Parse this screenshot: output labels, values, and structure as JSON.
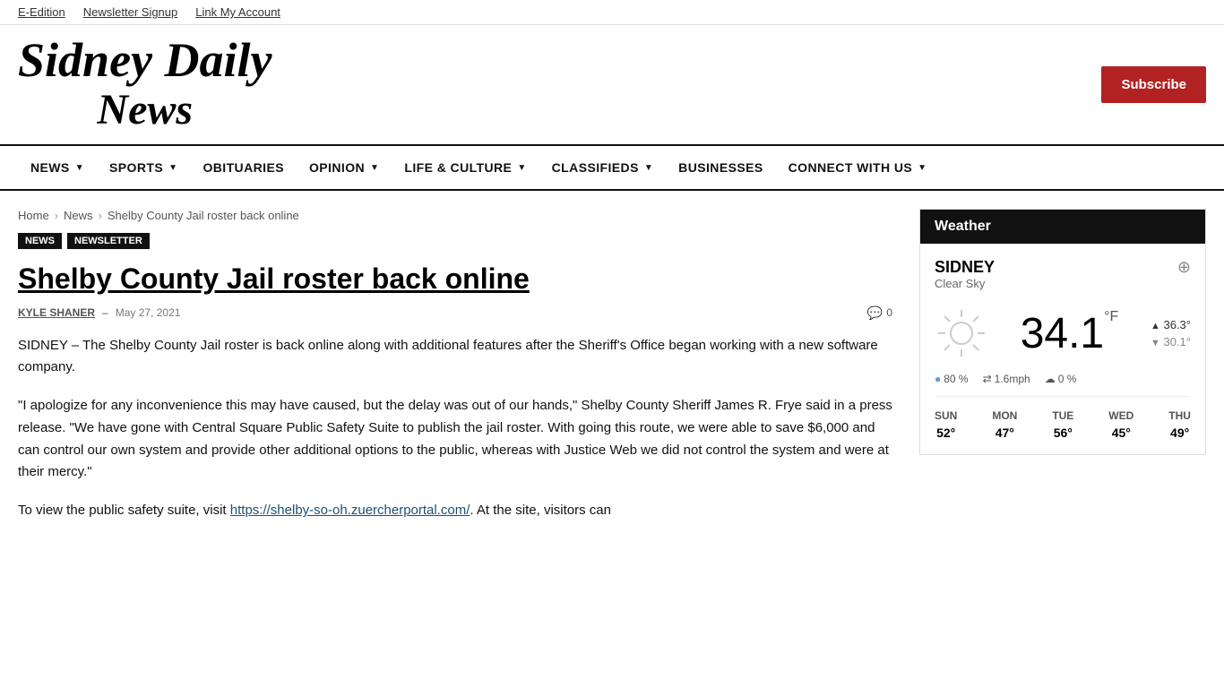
{
  "topbar": {
    "links": [
      {
        "label": "E-Edition"
      },
      {
        "label": "Newsletter Signup"
      },
      {
        "label": "Link My Account"
      }
    ]
  },
  "header": {
    "logo_line1": "Sidney Daily",
    "logo_line2": "News",
    "subscribe_label": "Subscribe"
  },
  "nav": {
    "items": [
      {
        "label": "NEWS",
        "has_dropdown": true
      },
      {
        "label": "SPORTS",
        "has_dropdown": true
      },
      {
        "label": "OBITUARIES",
        "has_dropdown": false
      },
      {
        "label": "OPINION",
        "has_dropdown": true
      },
      {
        "label": "LIFE & CULTURE",
        "has_dropdown": true
      },
      {
        "label": "CLASSIFIEDS",
        "has_dropdown": true
      },
      {
        "label": "BUSINESSES",
        "has_dropdown": false
      },
      {
        "label": "CONNECT WITH US",
        "has_dropdown": true
      }
    ]
  },
  "breadcrumb": {
    "home": "Home",
    "news": "News",
    "current": "Shelby County Jail roster back online"
  },
  "tags": [
    {
      "label": "News"
    },
    {
      "label": "Newsletter"
    }
  ],
  "article": {
    "title": "Shelby County Jail roster back online",
    "author": "KYLE SHANER",
    "date": "May 27, 2021",
    "comments": "0",
    "body_p1": "SIDNEY – The Shelby County Jail roster is back online along with additional features after the Sheriff's Office began working with a new software company.",
    "body_p2": "\"I apologize for any inconvenience this may have caused, but the delay was out of our hands,\" Shelby County Sheriff James R. Frye said in a press release. \"We have gone with Central Square Public Safety Suite to publish the jail roster. With going this route, we were able to save $6,000 and can control our own system and provide other additional options to the public, whereas with Justice Web we did not control the system and were at their mercy.\"",
    "body_p3_start": "To view the public safety suite, visit ",
    "body_p3_link": "https://shelby-so-oh.zuercherportal.com/",
    "body_p3_end": ". At the site, visitors can"
  },
  "weather": {
    "header_label": "Weather",
    "city": "SIDNEY",
    "description": "Clear Sky",
    "temperature": "34.1",
    "unit": "°F",
    "high": "36.3°",
    "low": "30.1°",
    "humidity": "80 %",
    "wind": "1.6mph",
    "precipitation": "0 %",
    "forecast": [
      {
        "day": "SUN",
        "temp": "52°"
      },
      {
        "day": "MON",
        "temp": "47°"
      },
      {
        "day": "TUE",
        "temp": "56°"
      },
      {
        "day": "WED",
        "temp": "45°"
      },
      {
        "day": "THU",
        "temp": "49°"
      }
    ]
  }
}
